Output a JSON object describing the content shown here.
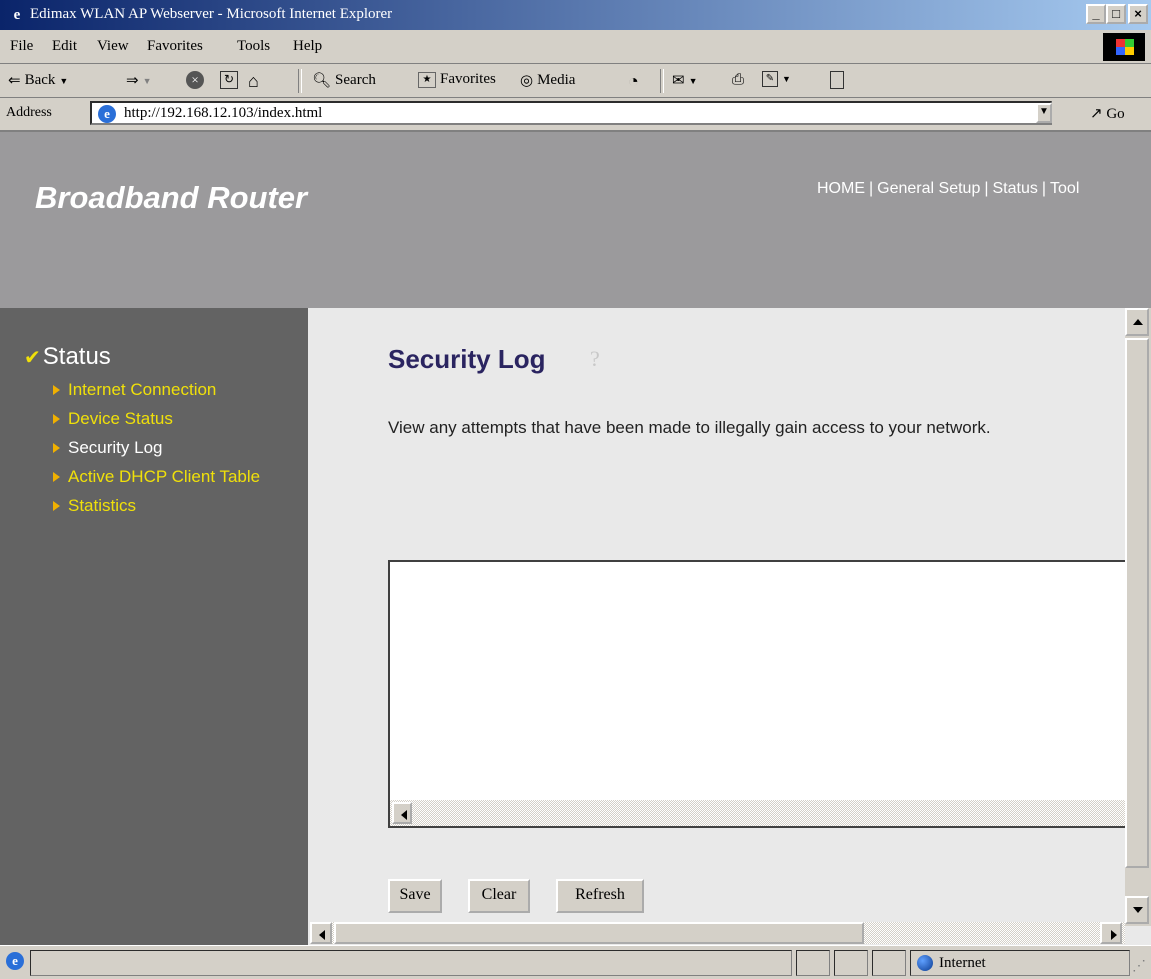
{
  "window": {
    "title": "Edimax WLAN AP Webserver - Microsoft Internet Explorer",
    "controls": {
      "minimize": "_",
      "maximize": "□",
      "close": "×"
    }
  },
  "menu": [
    "File",
    "Edit",
    "View",
    "Favorites",
    "Tools",
    "Help"
  ],
  "toolbar": {
    "back": "Back",
    "search": "Search",
    "favorites": "Favorites",
    "media": "Media"
  },
  "address": {
    "label": "Address",
    "url": "http://192.168.12.103/index.html",
    "go": "Go"
  },
  "page": {
    "brand": "Broadband Router",
    "topnav": [
      "HOME",
      "General Setup",
      "Status",
      "Tool"
    ],
    "sidebar": {
      "title": "Status",
      "items": [
        {
          "label": "Internet Connection",
          "active": false
        },
        {
          "label": "Device Status",
          "active": false
        },
        {
          "label": "Security Log",
          "active": true
        },
        {
          "label": "Active DHCP Client Table",
          "active": false
        },
        {
          "label": "Statistics",
          "active": false
        }
      ]
    },
    "section_title": "Security Log",
    "description": "View any attempts that have been made to illegally gain access to your network.",
    "log_text": "",
    "buttons": {
      "save": "Save",
      "clear": "Clear",
      "refresh": "Refresh"
    }
  },
  "statusbar": {
    "zone": "Internet"
  },
  "colors": {
    "header_bg": "#9b9a9c",
    "sidebar_bg": "#636363",
    "link_yellow": "#f0e00a",
    "title_navy": "#2a2460"
  }
}
